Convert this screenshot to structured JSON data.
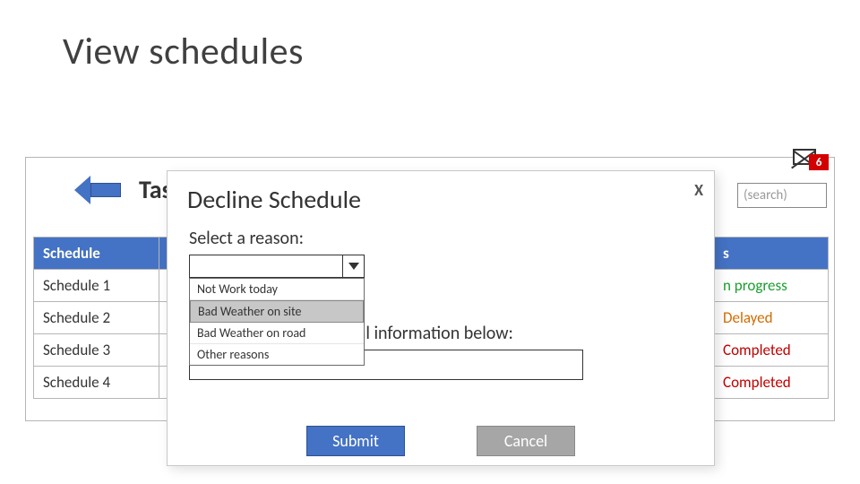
{
  "page": {
    "title": "View schedules"
  },
  "panel": {
    "title": "Task",
    "search_placeholder": "(search)",
    "badge_count": "6"
  },
  "table": {
    "header_schedule": "Schedule",
    "header_status_suffix": "s",
    "rows": [
      {
        "name": "Schedule 1",
        "status_text": "n progress",
        "status_class": "status-ip"
      },
      {
        "name": "Schedule 2",
        "status_text": "Delayed",
        "status_class": "status-dl"
      },
      {
        "name": "Schedule 3",
        "status_text": "Completed",
        "status_class": "status-cp"
      },
      {
        "name": "Schedule 4",
        "status_text": "Completed",
        "status_class": "status-cp"
      }
    ]
  },
  "modal": {
    "title": "Decline Schedule",
    "close": "X",
    "reason_label": "Select a reason:",
    "options": [
      {
        "label": "Not Work today",
        "selected": false
      },
      {
        "label": "Bad Weather on site",
        "selected": true
      },
      {
        "label": "Bad Weather on road",
        "selected": false
      },
      {
        "label": "Other reasons",
        "selected": false
      }
    ],
    "additional_label": "Please include additional information below:",
    "submit": "Submit",
    "cancel": "Cancel"
  }
}
